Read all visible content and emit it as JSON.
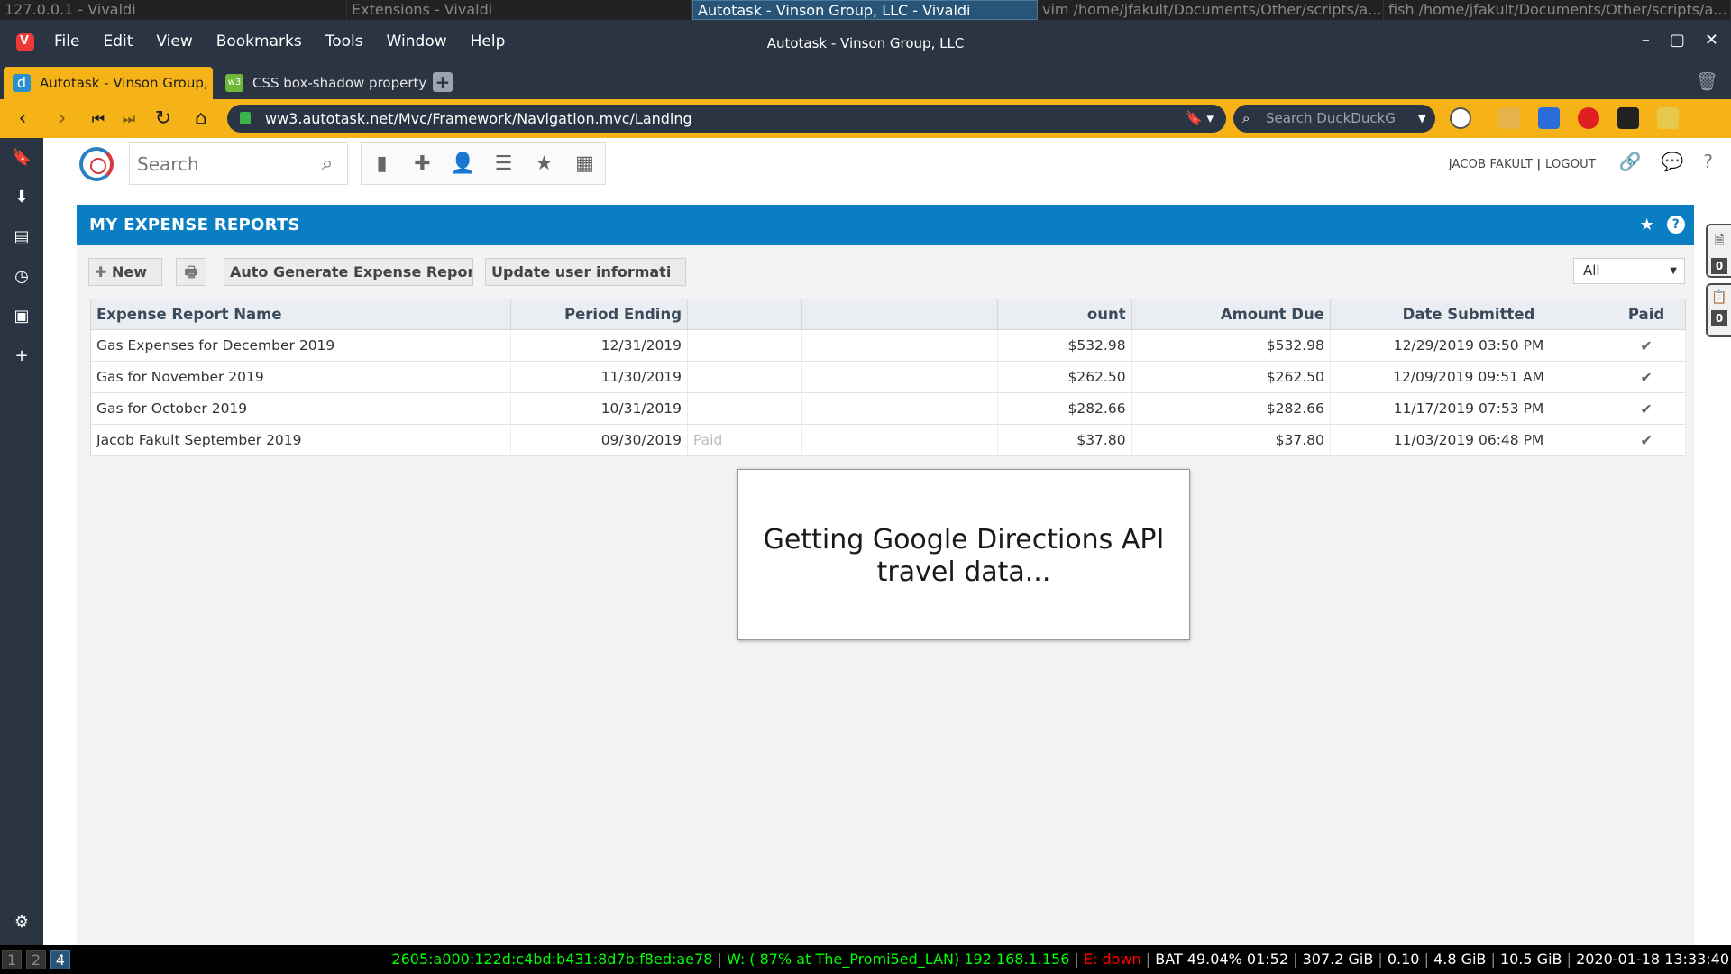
{
  "wm": {
    "windows": [
      "127.0.0.1 - Vivaldi",
      "Extensions - Vivaldi",
      "Autotask - Vinson Group, LLC - Vivaldi",
      "vim /home/jfakult/Documents/Other/scripts/a...",
      "fish /home/jfakult/Documents/Other/scripts/a..."
    ]
  },
  "browser": {
    "menus": [
      "File",
      "Edit",
      "View",
      "Bookmarks",
      "Tools",
      "Window",
      "Help"
    ],
    "window_title": "Autotask - Vinson Group, LLC",
    "tabs": [
      {
        "label": "Autotask - Vinson Group, L",
        "icon": "d"
      },
      {
        "label": "CSS box-shadow property",
        "icon": "w3"
      }
    ],
    "url": "ww3.autotask.net/Mvc/Framework/Navigation.mvc/Landing",
    "search_placeholder": "Search DuckDuckG",
    "accent": "#f6b318",
    "chrome_color": "#2b3442"
  },
  "autotask": {
    "search_placeholder": "Search",
    "user": "JACOB FAKULT",
    "logout": "LOGOUT",
    "panel_title": "MY EXPENSE REPORTS",
    "buttons": {
      "new": "New",
      "auto_generate": "Auto Generate Expense Report",
      "update_user": "Update user informati"
    },
    "filter": "All",
    "columns": [
      "Expense Report Name",
      "Period Ending",
      "ount",
      "Amount Due",
      "Date Submitted",
      "Paid"
    ],
    "rows": [
      {
        "name": "Gas Expenses for December 2019",
        "period": "12/31/2019",
        "status": "",
        "amount": "$532.98",
        "due": "$532.98",
        "submitted": "12/29/2019 03:50 PM"
      },
      {
        "name": "Gas for November 2019",
        "period": "11/30/2019",
        "status": "",
        "amount": "$262.50",
        "due": "$262.50",
        "submitted": "12/09/2019 09:51 AM"
      },
      {
        "name": "Gas for October 2019",
        "period": "10/31/2019",
        "status": "",
        "amount": "$282.66",
        "due": "$282.66",
        "submitted": "11/17/2019 07:53 PM"
      },
      {
        "name": "Jacob Fakult September 2019",
        "period": "09/30/2019",
        "status": "Paid",
        "amount": "$37.80",
        "due": "$37.80",
        "submitted": "11/03/2019 06:48 PM"
      }
    ],
    "widget_counts": [
      "0",
      "0"
    ],
    "loading_message": "Getting Google Directions API travel data...",
    "brand_blue": "#0a7ec2"
  },
  "statusbar": {
    "workspaces": [
      "1",
      "2",
      "4"
    ],
    "ipv6": "2605:a000:122d:c4bd:b431:8d7b:f8ed:ae78",
    "wifi": "W: ( 87% at The_Promi5ed_LAN) 192.168.1.156",
    "eth": "E: down",
    "battery": "BAT 49.04% 01:52",
    "disk": "307.2 GiB",
    "load": "0.10",
    "mem_used": "4.8 GiB",
    "mem_total": "10.5 GiB",
    "datetime": "2020-01-18 13:33:40"
  }
}
